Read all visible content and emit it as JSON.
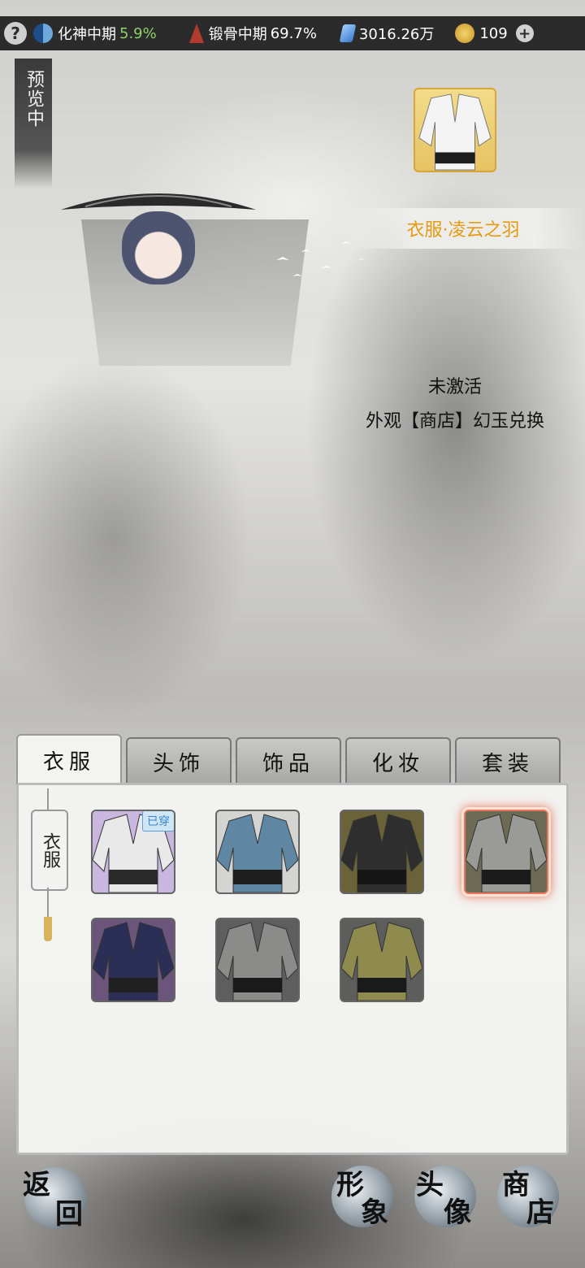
{
  "topbar": {
    "help_label": "?",
    "stats": [
      {
        "icon": "yin-yang-icon",
        "label": "化神中期",
        "value": "5.9%"
      },
      {
        "icon": "bone-forging-icon",
        "label": "锻骨中期",
        "value": "69.7%"
      },
      {
        "icon": "spirit-stone-icon",
        "label": "3016.26万",
        "value": ""
      },
      {
        "icon": "jade-coin-icon",
        "label": "109",
        "value": ""
      }
    ],
    "plus_label": "+"
  },
  "preview_label": "预览中",
  "item": {
    "name": "衣服·凌云之羽",
    "status": "未激活",
    "source": "外观【商店】幻玉兑换"
  },
  "tabs": [
    "衣服",
    "头饰",
    "饰品",
    "化妆",
    "套装"
  ],
  "active_tab": 0,
  "category_label": "衣服",
  "outfits": [
    {
      "name": "outfit-white-purple",
      "badge": "已穿",
      "colors": [
        "#c9b7e0",
        "#e9e9e9",
        "#2a2a2a"
      ]
    },
    {
      "name": "outfit-blue",
      "badge": "",
      "colors": [
        "#d4d4d2",
        "#5f87a3",
        "#1e1e1e"
      ]
    },
    {
      "name": "outfit-black",
      "badge": "",
      "colors": [
        "#6a6238",
        "#2e2e2e",
        "#161616"
      ]
    },
    {
      "name": "outfit-grey-selected",
      "badge": "",
      "colors": [
        "#6d6a55",
        "#9a9a97",
        "#1b1b1b"
      ]
    },
    {
      "name": "outfit-navy",
      "badge": "",
      "colors": [
        "#6b557a",
        "#2c2f55",
        "#202020"
      ]
    },
    {
      "name": "outfit-grey",
      "badge": "",
      "colors": [
        "#5e5e5e",
        "#8b8b89",
        "#1a1a1a"
      ]
    },
    {
      "name": "outfit-olive",
      "badge": "",
      "colors": [
        "#5d5d5b",
        "#8f8a4e",
        "#1a1a1a"
      ]
    }
  ],
  "selected_outfit": 3,
  "bottom_buttons": {
    "back": [
      "返",
      "回"
    ],
    "appearance": [
      "形",
      "象"
    ],
    "avatar": [
      "头",
      "像"
    ],
    "shop": [
      "商",
      "店"
    ]
  },
  "colors": {
    "accent": "#e59a12",
    "selected_glow": "#e8785a"
  }
}
